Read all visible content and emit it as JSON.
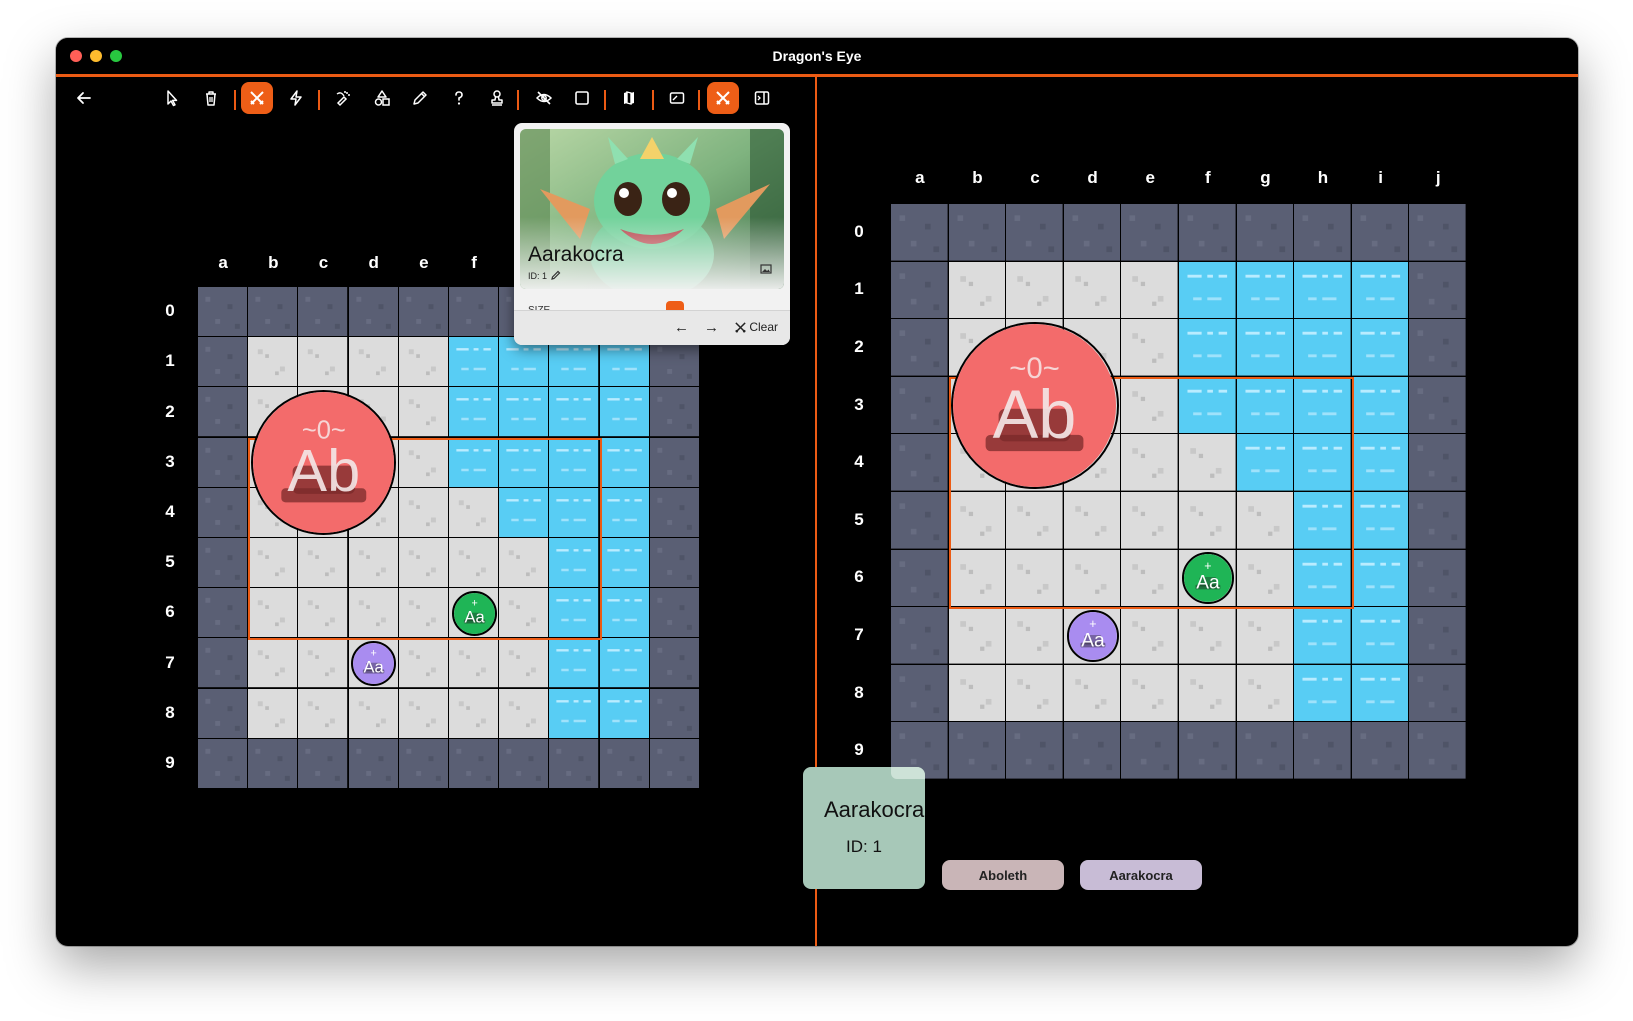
{
  "window": {
    "title": "Dragon's Eye"
  },
  "toolbar": {
    "tools": [
      {
        "icon": "back-arrow-icon",
        "active": false
      },
      {
        "icon": "pointer-icon",
        "active": false
      },
      {
        "icon": "trash-icon",
        "active": false
      },
      {
        "icon": "crossed-swords-icon",
        "active": true
      },
      {
        "icon": "lightning-icon",
        "active": false
      },
      {
        "icon": "spray-icon",
        "active": false
      },
      {
        "icon": "shapes-icon",
        "active": false
      },
      {
        "icon": "pencil-icon",
        "active": false
      },
      {
        "icon": "question-icon",
        "active": false
      },
      {
        "icon": "stamp-icon",
        "active": false
      },
      {
        "icon": "eye-off-icon",
        "active": false
      },
      {
        "icon": "square-icon",
        "active": false
      },
      {
        "icon": "map-icon",
        "active": false
      },
      {
        "icon": "screen-icon",
        "active": false
      },
      {
        "icon": "crossed-swords-icon",
        "active": true
      },
      {
        "icon": "sidebar-icon",
        "active": false
      }
    ]
  },
  "colors": {
    "accent": "#ec5b14",
    "wall": "#5a5f74",
    "floor": "#dcdcdc",
    "water": "#58cdf4",
    "aboleth": "#f36b6b",
    "aarakocra_green": "#1fb556",
    "aarakocra_purple": "#a98cf0"
  },
  "grid": {
    "cols": [
      "a",
      "b",
      "c",
      "d",
      "e",
      "f",
      "g",
      "h",
      "i",
      "j"
    ],
    "rows": [
      "0",
      "1",
      "2",
      "3",
      "4",
      "5",
      "6",
      "7",
      "8",
      "9"
    ],
    "map": [
      "WWWWWWWWWW",
      "WFFFFAAAAW",
      "WFFFFAAAAW",
      "WFFFFAAAAW",
      "WFFFFFAAAW",
      "WFFFFFFAAW",
      "WFFFFFFAAW",
      "WFFFFFFAAW",
      "WFFFFFFAAW",
      "WWWWWWWWWW"
    ]
  },
  "tokens": {
    "large": {
      "label": "Ab",
      "badge": "~0~"
    },
    "small": {
      "label": "Aa",
      "badge": "+"
    }
  },
  "popup": {
    "name": "Aarakocra",
    "id_label": "ID: 1",
    "size_label": "SIZE",
    "clear_label": "Clear"
  },
  "card": {
    "name": "Aarakocra",
    "id_label": "ID: 1"
  },
  "chips": [
    {
      "label": "Aboleth",
      "color": "#c9b5b7"
    },
    {
      "label": "Aarakocra",
      "color": "#c8bcd6"
    }
  ]
}
